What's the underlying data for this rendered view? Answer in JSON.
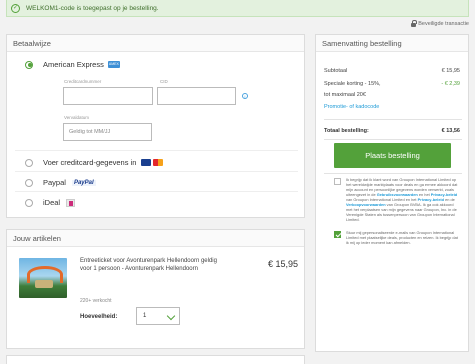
{
  "banner": {
    "message": "WELKOM1-code is toegepast op je bestelling."
  },
  "secure_label": "Beveiligde transactie",
  "payment": {
    "title": "Betaalwijze",
    "amex_label": "American Express",
    "card_number_label": "Creditcardnummer",
    "cid_label": "CID",
    "expiry_label": "Vervaldatum",
    "expiry_placeholder": "Geldig tot MM/JJ",
    "creditcard_label": "Voer creditcard-gegevens in",
    "paypal_label": "Paypal",
    "paypal_logo": "PayPal",
    "ideal_label": "iDeal"
  },
  "items": {
    "title": "Jouw artikelen",
    "product_title": "Entreeticket voor Avonturenpark Hellendoorn geldig voor 1 persoon - Avonturenpark Hellendoorn",
    "price": "€ 15,95",
    "sold": "220+ verkocht",
    "quantity_label": "Hoeveelheid:",
    "quantity_value": "1"
  },
  "summary": {
    "title": "Samenvatting bestelling",
    "subtotal_label": "Subtotaal",
    "subtotal_value": "€ 15,95",
    "discount_label": "Speciale korting - 15%,",
    "discount_value": "- € 2,39",
    "discount_note": "tot maximaal 20€",
    "promo_link": "Promotie- of kadocode",
    "total_label": "Totaal bestelling:",
    "total_value": "€ 13,56",
    "order_button": "Plaats bestelling",
    "legal1_a": "Ik begrijp dat ik klant word van Groupon International Limited op het wereldwijde marktplaats voor deals en ga ermee akkoord dat mijn account en persoonlijke gegevens worden verwerkt, zoals uiteengezet in de ",
    "legal1_link1": "Gebruiksvoorwaarden",
    "legal1_b": " en het ",
    "legal1_link2": "Privacy-beleid",
    "legal1_c": " van Groupon International Limited en het ",
    "legal1_link3": "Privacy-beleid",
    "legal1_d": " en de ",
    "legal1_link4": "Verkoopvoorwaarden",
    "legal1_e": " van Groupon BVBA. Ik ga ook akkoord met het verplaatsen van mijn gegevens naar Groupon, Inc. in de Verenigde Staten als tussenpersoon van Groupon International Limited.",
    "legal2": "Stuur mij gepersonaliseerde e-mails van Groupon International Limited met plaatselijke deals, producten en reizen. Ik begrijp dat ik mij op ieder moment kan afmelden."
  }
}
